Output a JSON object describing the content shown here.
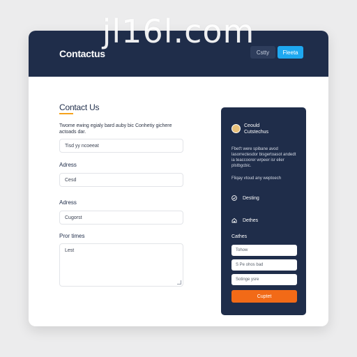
{
  "watermark": "jl16l.com",
  "header": {
    "brand": "Contactus",
    "ghost_button": "Cstty",
    "primary_button": "Fleeta"
  },
  "form": {
    "title": "Contact Us",
    "description": "Twome ewing egialy bard auby bic Conhetiy gichere actoads dar.",
    "fields": [
      {
        "label": "",
        "value": "Tisd yy ncoeeat"
      },
      {
        "label": "Adress",
        "value": "Cesd"
      },
      {
        "label": "Adress",
        "value": "Cugorst"
      }
    ],
    "textarea": {
      "label": "Pror times",
      "value": "Lest"
    }
  },
  "panel": {
    "title_line1": "Ceould",
    "title_line2": "Cutstechus",
    "text": "Fbet't were spibane avod lasorrectesdor bisgertoasot andedt ia teaccoorer wrpeer isr elier plstbgcbic.",
    "note": "Fliqay vtoud any weptoech",
    "items": [
      {
        "icon": "check-circle-icon",
        "label": "Desting"
      },
      {
        "icon": "home-icon",
        "label": "Dethes"
      }
    ],
    "section": "Cathes",
    "fields": [
      "Tohow",
      "S Pe ohos bad",
      "Sotinge ysre"
    ],
    "submit": "Cuptet"
  }
}
